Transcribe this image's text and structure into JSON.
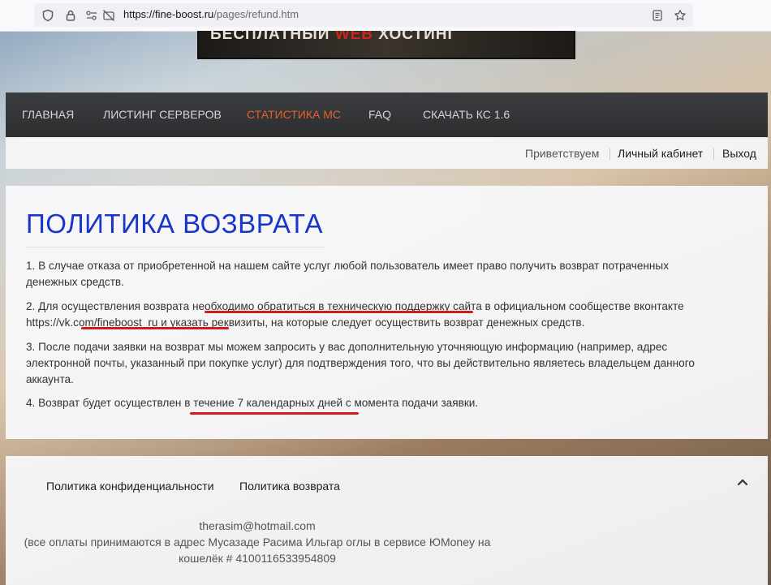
{
  "browser": {
    "url_host": "https://fine-boost.ru",
    "url_path": "/pages/refund.htm"
  },
  "banner": {
    "text_prefix": "БЕСПЛАТНЫЙ ",
    "text_accent": "WEB",
    "text_suffix": " ХОСТИНГ"
  },
  "nav": {
    "items": [
      {
        "label": "ГЛАВНАЯ"
      },
      {
        "label": "ЛИСТИНГ СЕРВЕРОВ"
      },
      {
        "label": "СТАТИСТИКА МС"
      },
      {
        "label": "FAQ"
      },
      {
        "label": "СКАЧАТЬ КС 1.6"
      }
    ],
    "active_color": "#e2622d"
  },
  "userbar": {
    "greeting": "Приветствуем",
    "cabinet": "Личный кабинет",
    "logout": "Выход"
  },
  "content": {
    "title": "ПОЛИТИКА ВОЗВРАТА",
    "p1": "1. В случае отказа от приобретенной на нашем сайте услуг любой пользователь имеет право получить возврат потраченных денежных средств.",
    "p2": "2. Для осуществления возврата необходимо обратиться в техническую поддержку сайта в официальном сообществе вконтакте https://vk.com/fineboost_ru и указать реквизиты, на которые следует осуществить возврат денежных средств.",
    "p3": "3. После подачи заявки на возврат мы можем запросить у вас дополнительную уточняющую информацию (например, адрес электронной почты, указанный при покупке услуг) для подтверждения того, что вы действительно являетесь владельцем данного аккаунта.",
    "p4": "4. Возврат будет осуществлен в течение 7 календарных дней с момента подачи заявки."
  },
  "footer": {
    "privacy_link": "Политика конфиденциальности",
    "refund_link": "Политика возврата",
    "email": "therasim@hotmail.com",
    "payment_note": "(все оплаты принимаются в адрес Мусазаде Расима Ильгар оглы в сервисе ЮMoney на кошелёк # 4100116533954809"
  },
  "colors": {
    "title": "#1a35c9",
    "underline": "#d21b1b"
  }
}
